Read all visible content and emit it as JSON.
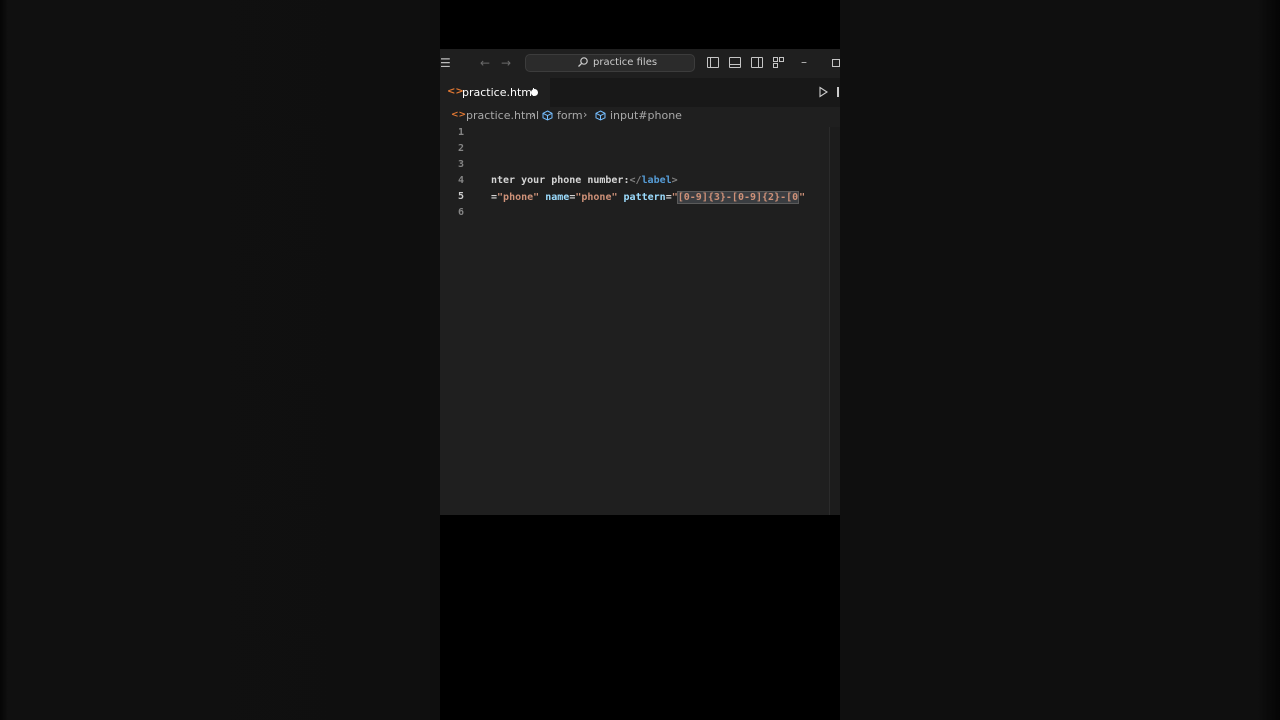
{
  "window": {
    "search_placeholder": "practice files"
  },
  "tab": {
    "icon": "<>",
    "label": "practice.html"
  },
  "breadcrumb": {
    "file": "practice.html",
    "item1": "form",
    "item2": "input#phone"
  },
  "editor": {
    "line_numbers": [
      "1",
      "2",
      "3",
      "4",
      "5",
      "6"
    ],
    "line4": {
      "text": "nter your phone number:",
      "close_open": "</",
      "close_tag": "label",
      "close_end": ">"
    },
    "line5": {
      "frag_eq": "=",
      "id_val": "\"phone\"",
      "name_attr": "name",
      "eq2": "=",
      "name_val": "\"phone\"",
      "pattern_attr": "pattern",
      "eq3": "=",
      "quote_open": "\"",
      "pattern_sel": "[0-9]{3}-[0-9]{2}-[0",
      "quote_close": "\""
    }
  },
  "colors": {
    "editor_bg": "#1f1f1f",
    "tab_accent_html": "#e37933",
    "tag": "#569cd6",
    "attr": "#9cdcfe",
    "string": "#ce9178"
  }
}
